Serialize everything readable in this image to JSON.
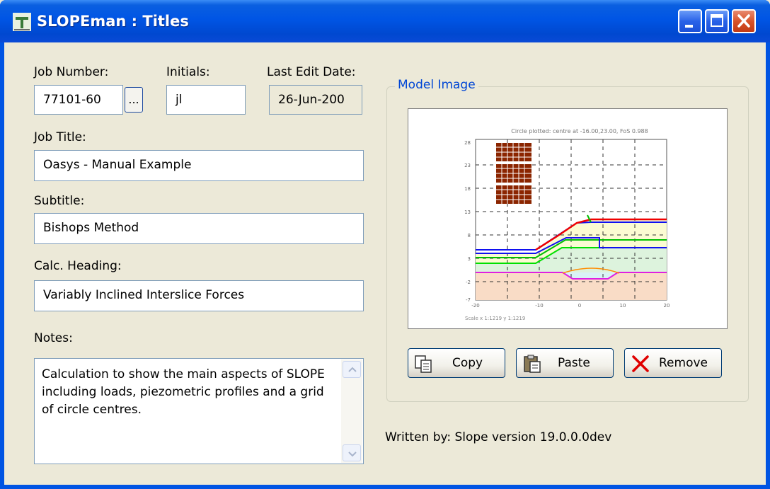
{
  "window": {
    "title": "SLOPEman : Titles"
  },
  "form": {
    "job_number_label": "Job Number:",
    "job_number_value": "77101-60",
    "browse_label": "...",
    "initials_label": "Initials:",
    "initials_value": "jl",
    "last_edit_label": "Last Edit Date:",
    "last_edit_value": "26-Jun-200",
    "job_title_label": "Job Title:",
    "job_title_value": "Oasys - Manual Example",
    "subtitle_label": "Subtitle:",
    "subtitle_value": "Bishops Method",
    "calc_heading_label": "Calc. Heading:",
    "calc_heading_value": "Variably Inclined Interslice Forces",
    "notes_label": "Notes:",
    "notes_value": "Calculation to show the main aspects of SLOPE including loads, piezometric profiles and a grid of circle centres."
  },
  "model_image": {
    "group_label": "Model Image",
    "plot_title": "Circle plotted: centre at -16.00,23.00, FoS 0.988",
    "scale_text": "Scale x 1:1219 y 1:1219",
    "y_ticks": [
      "28",
      "23",
      "18",
      "13",
      "8",
      "3",
      "-2",
      "-7"
    ],
    "x_ticks": [
      "-20",
      "-10",
      "0",
      "10",
      "20"
    ],
    "copy_label": "Copy",
    "paste_label": "Paste",
    "remove_label": "Remove"
  },
  "footer": {
    "written_by": "Written by: Slope version 19.0.0.0dev"
  },
  "colors": {
    "titlebar": "#0054e3",
    "face": "#ece9d8",
    "group_title": "#0046d5"
  }
}
